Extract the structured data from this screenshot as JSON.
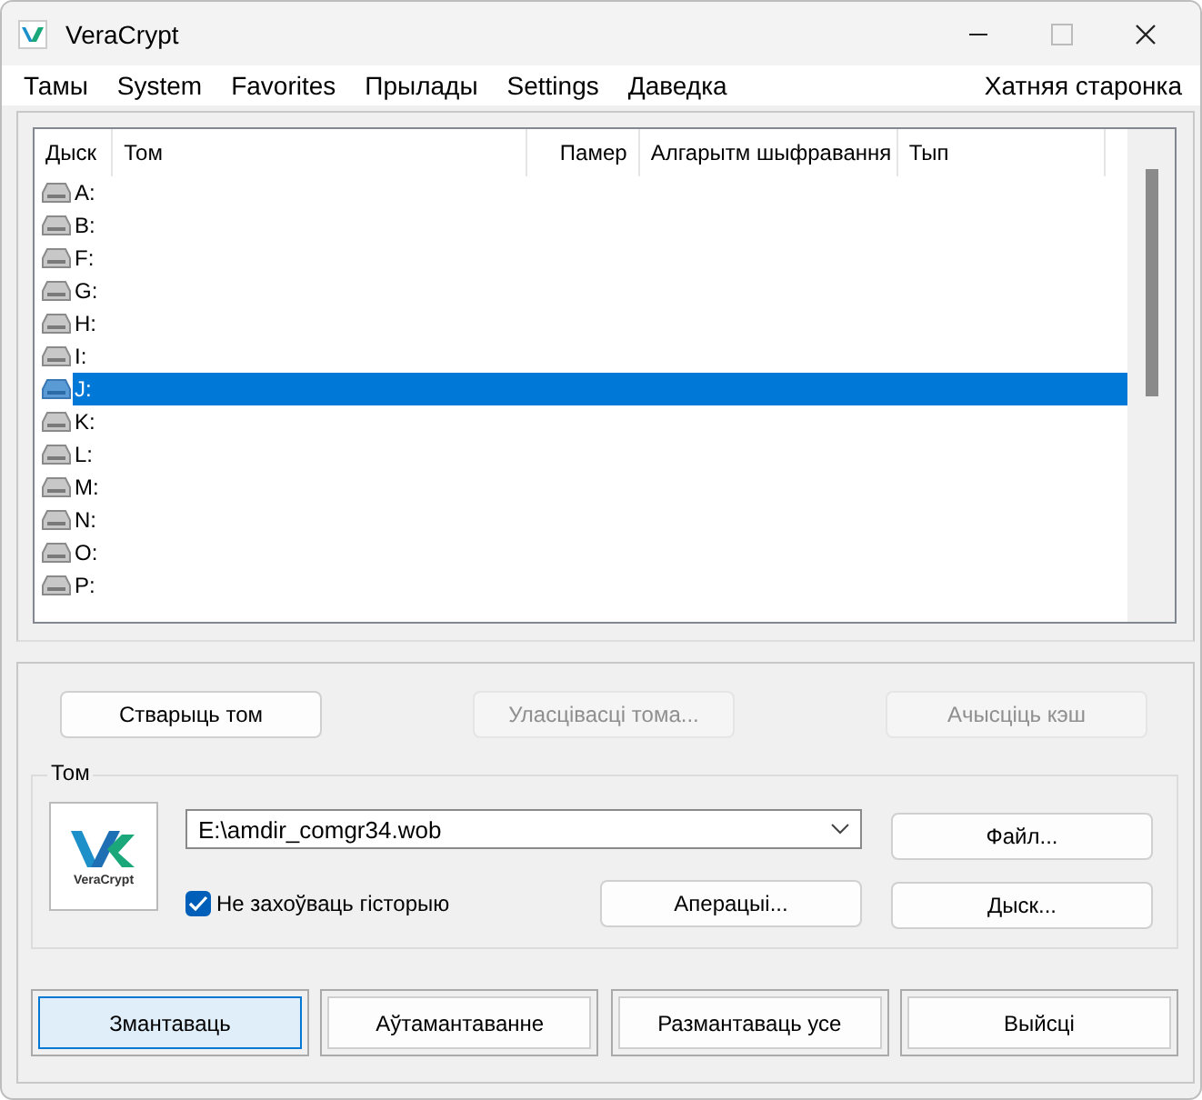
{
  "window": {
    "title": "VeraCrypt"
  },
  "menu": [
    "Тамы",
    "System",
    "Favorites",
    "Прылады",
    "Settings",
    "Даведка"
  ],
  "homepage_link": "Хатняя старонка",
  "drive_table": {
    "columns": [
      "Дыск",
      "Том",
      "Памер",
      "Алгарытм шыфравання",
      "Тып"
    ],
    "rows": [
      {
        "drive": "A:",
        "selected": false
      },
      {
        "drive": "B:",
        "selected": false
      },
      {
        "drive": "F:",
        "selected": false
      },
      {
        "drive": "G:",
        "selected": false
      },
      {
        "drive": "H:",
        "selected": false
      },
      {
        "drive": "I:",
        "selected": false
      },
      {
        "drive": "J:",
        "selected": true
      },
      {
        "drive": "K:",
        "selected": false
      },
      {
        "drive": "L:",
        "selected": false
      },
      {
        "drive": "M:",
        "selected": false
      },
      {
        "drive": "N:",
        "selected": false
      },
      {
        "drive": "O:",
        "selected": false
      },
      {
        "drive": "P:",
        "selected": false
      }
    ]
  },
  "top_buttons": [
    {
      "label": "Стварыць том",
      "disabled": false
    },
    {
      "label": "Уласцівасці тома...",
      "disabled": true
    },
    {
      "label": "Ачысціць кэш",
      "disabled": true
    }
  ],
  "volume": {
    "title": "Том",
    "logo_text": "VeraCrypt",
    "path": "E:\\amdir_comgr34.wob",
    "never_save_history": {
      "label": "Не захоўваць гісторыю",
      "checked": true
    },
    "file_button": "Файл...",
    "operations_button": "Аперацыі...",
    "device_button": "Дыск..."
  },
  "bottom_buttons": [
    {
      "label": "Змантаваць",
      "focused": true
    },
    {
      "label": "Аўтамантаванне",
      "focused": false
    },
    {
      "label": "Размантаваць усе",
      "focused": false
    },
    {
      "label": "Выйсці",
      "focused": false
    }
  ]
}
